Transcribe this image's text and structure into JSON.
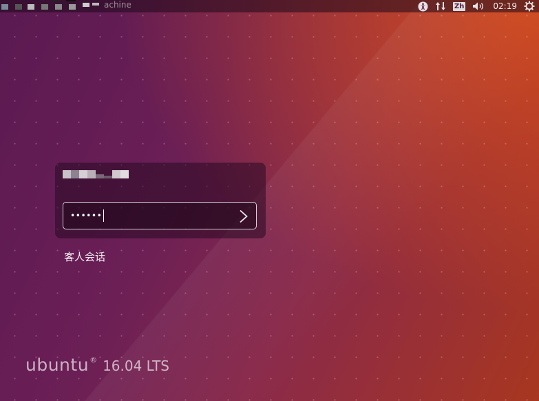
{
  "topbar": {
    "hostname": "achine",
    "indicators": [
      {
        "icon": "accessibility-icon"
      },
      {
        "icon": "network-arrows-icon"
      },
      {
        "icon": "keyboard-layout-icon",
        "label": "Zh"
      },
      {
        "icon": "volume-icon"
      },
      {
        "icon": "clock",
        "label": "02:19"
      },
      {
        "icon": "power-gear-icon"
      }
    ],
    "clock": "02:19",
    "keyboard_layout": "Zh"
  },
  "login": {
    "password_value": "••••••",
    "submit_icon": "chevron-right-icon"
  },
  "guest_session": "客人会话",
  "branding": {
    "word": "ubuntu",
    "mark": "®",
    "version": "16.04 LTS"
  },
  "colors": {
    "background_left": "#5a1a52",
    "background_right": "#a8361f",
    "login_box": "#2a0a23",
    "text": "#f4eef2"
  }
}
